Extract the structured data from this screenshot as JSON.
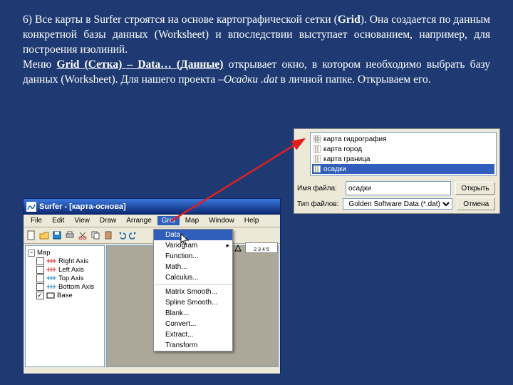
{
  "para": {
    "p1a": "6) Все карты в Surfer  строятся на основе картографической сетки (",
    "p1b": "Grid",
    "p1c": "). Она создается по данным конкретной базы данных (Worksheet) и впоследствии  выступает основанием, например, для построения изолиний.",
    "p2a": "Меню ",
    "p2b": "Grid (Сетка) – Data… (Данные)",
    "p2c": " открывает окно, в котором необходимо выбрать базу данных (Worksheet). Для нашего проекта –",
    "p2d": "Осадки .dat",
    "p2e": " в личной папке. Открываем его."
  },
  "openDlg": {
    "files": [
      {
        "name": "карта гидрография"
      },
      {
        "name": "карта город"
      },
      {
        "name": "карта граница"
      },
      {
        "name": "осадки",
        "selected": true
      }
    ],
    "fileLabel": "Имя файла:",
    "fileValue": "осадки",
    "typeLabel": "Тип файлов:",
    "typeValue": "Golden Software Data (*.dat)",
    "openBtn": "Открыть",
    "cancelBtn": "Отмена"
  },
  "surfer": {
    "title": "Surfer - [карта-основа]",
    "menu": [
      "File",
      "Edit",
      "View",
      "Draw",
      "Arrange",
      "Grid",
      "Map",
      "Window",
      "Help"
    ],
    "openMenuIndex": 5,
    "grid_menu": [
      {
        "label": "Data...",
        "hi": true
      },
      {
        "label": "Variogram",
        "sub": true
      },
      {
        "label": "Function..."
      },
      {
        "label": "Math..."
      },
      {
        "label": "Calculus..."
      },
      {
        "sep": true
      },
      {
        "label": "Matrix Smooth..."
      },
      {
        "label": "Spline Smooth..."
      },
      {
        "label": "Blank..."
      },
      {
        "label": "Convert..."
      },
      {
        "label": "Extract..."
      },
      {
        "label": "Transform"
      }
    ],
    "objMgr": {
      "root": "Map",
      "items": [
        {
          "label": "Right Axis",
          "checked": false,
          "color": "#d22"
        },
        {
          "label": "Left Axis",
          "checked": false,
          "color": "#d22"
        },
        {
          "label": "Top Axis",
          "checked": false,
          "color": "#28c"
        },
        {
          "label": "Bottom Axis",
          "checked": false,
          "color": "#28c"
        },
        {
          "label": "Base",
          "checked": true,
          "color": "#000"
        }
      ]
    },
    "ruler_marks": "2  3  4  5"
  }
}
